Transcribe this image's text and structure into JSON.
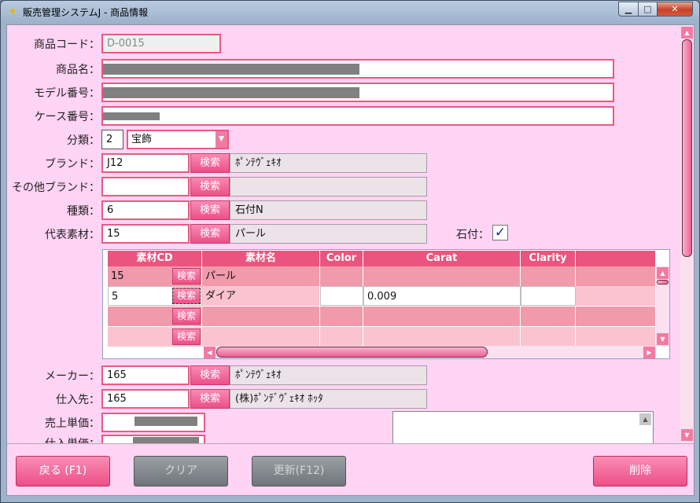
{
  "window": {
    "title": "販売管理システムJ - 商品情報",
    "min_glyph": "▁",
    "max_glyph": "□",
    "close_glyph": "✕",
    "app_icon": "✦"
  },
  "form": {
    "product_code_label": "商品コード：",
    "product_code_value": "D-0015",
    "product_name_label": "商品名：",
    "model_number_label": "モデル番号：",
    "case_number_label": "ケース番号：",
    "category_label": "分類：",
    "category_code": "2",
    "category_name": "宝飾",
    "brand_label": "ブランド：",
    "brand_code": "J12",
    "brand_name": "ﾎﾟﾝﾃｳﾞｪｷｵ",
    "other_brand_label": "その他ブランド：",
    "other_brand_code": "",
    "other_brand_name": "",
    "kind_label": "種類：",
    "kind_code": "6",
    "kind_name": "石付N",
    "main_material_label": "代表素材：",
    "main_material_code": "15",
    "main_material_name": "パール",
    "stone_label": "石付：",
    "stone_checked": "✓",
    "maker_label": "メーカー：",
    "maker_code": "165",
    "maker_name": "ﾎﾟﾝﾃｳﾞｪｷｵ",
    "supplier_label": "仕入先：",
    "supplier_code": "165",
    "supplier_name": "(株)ﾎﾟﾝﾃﾞｳﾞｪｷｵ ﾎｯﾀ",
    "sale_price_label": "売上単価：",
    "purchase_price_label": "仕入単価：",
    "search_label": "検索"
  },
  "grid": {
    "columns": [
      "素材CD",
      "素材名",
      "Color",
      "Carat",
      "Clarity"
    ],
    "rows": [
      {
        "cd": "15",
        "name": "パール",
        "color": "",
        "carat": "",
        "clarity": ""
      },
      {
        "cd": "5",
        "name": "ダイア",
        "color": "",
        "carat": "0.009",
        "clarity": ""
      },
      {
        "cd": "",
        "name": "",
        "color": "",
        "carat": "",
        "clarity": ""
      },
      {
        "cd": "",
        "name": "",
        "color": "",
        "carat": "",
        "clarity": ""
      }
    ],
    "search_label": "検索",
    "arrow_up": "▲",
    "arrow_down": "▼",
    "arrow_left": "◀",
    "arrow_right": "▶"
  },
  "buttons": {
    "back": "戻る (F1)",
    "clear": "クリア",
    "update": "更新(F12)",
    "delete": "削除"
  },
  "colors": {
    "accent": "#ec4f86",
    "background": "#ffd4f4"
  }
}
